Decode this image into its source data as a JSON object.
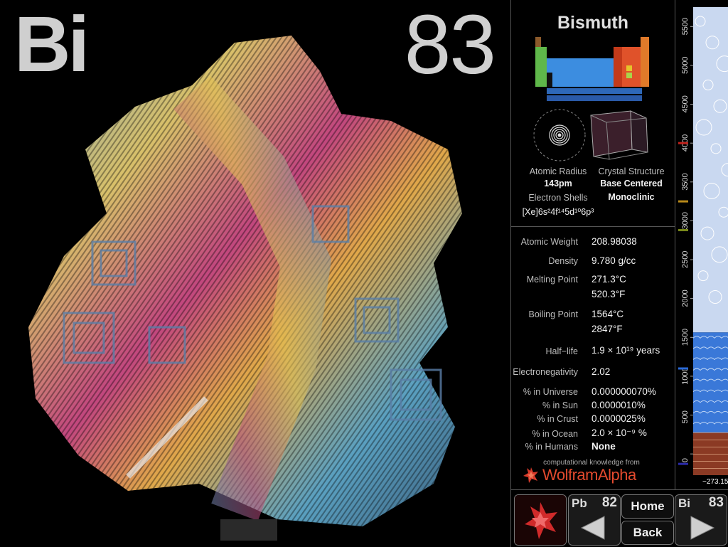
{
  "element": {
    "symbol": "Bi",
    "number": "83",
    "name": "Bismuth"
  },
  "summary": {
    "atomic_radius_label": "Atomic Radius",
    "atomic_radius_value": "143pm",
    "crystal_structure_label": "Crystal Structure",
    "crystal_structure_value_1": "Base Centered",
    "crystal_structure_value_2": "Monoclinic",
    "electron_shells_label": "Electron Shells",
    "electron_config": "[Xe]6s²4f¹⁴5d¹⁰6p³"
  },
  "properties": {
    "atomic_weight_label": "Atomic Weight",
    "atomic_weight": "208.98038",
    "density_label": "Density",
    "density": "9.780 g/cc",
    "melting_point_label": "Melting Point",
    "melting_c": "271.3°C",
    "melting_f": "520.3°F",
    "boiling_point_label": "Boiling Point",
    "boiling_c": "1564°C",
    "boiling_f": "2847°F",
    "half_life_label": "Half−life",
    "half_life": "1.9 × 10¹⁹ years",
    "electronegativity_label": "Electronegativity",
    "electronegativity": "2.02",
    "universe_label": "% in Universe",
    "universe": "0.000000070%",
    "sun_label": "% in Sun",
    "sun": "0.0000010%",
    "crust_label": "% in Crust",
    "crust": "0.0000025%",
    "ocean_label": "% in Ocean",
    "ocean": "2.0 × 10⁻⁹ %",
    "humans_label": "% in Humans",
    "humans": "None"
  },
  "branding": {
    "caption": "computational knowledge from",
    "name": "WolframAlpha"
  },
  "temperature_scale": {
    "ticks": [
      "5500",
      "5000",
      "4500",
      "4000",
      "3500",
      "3000",
      "2500",
      "2000",
      "1500",
      "1000",
      "500",
      "0"
    ],
    "bottom": "−273.15",
    "current_level": 1564,
    "markers": [
      4000,
      3250,
      2880,
      1100,
      0
    ],
    "colors": {
      "solid": "#8b3a24",
      "liquid": "#3a78d8",
      "gas": "#c9d8f0"
    }
  },
  "navigation": {
    "prev": {
      "symbol": "Pb",
      "number": "82"
    },
    "home_label": "Home",
    "back_label": "Back",
    "next": {
      "symbol": "Bi",
      "number": "83"
    }
  },
  "icons": [
    "wolfram-spikey-icon",
    "left-arrow-icon",
    "right-arrow-icon",
    "electron-shell-icon",
    "crystal-cell-icon",
    "periodic-table-icon"
  ]
}
